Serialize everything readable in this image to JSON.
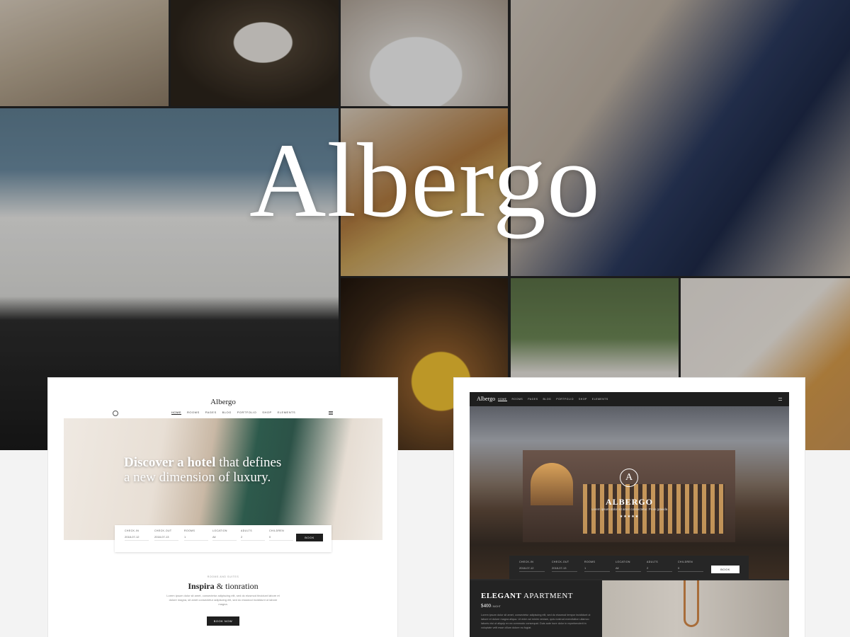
{
  "brand": {
    "name": "Albergo"
  },
  "light_demo": {
    "logo": "Albergo",
    "nav": [
      "HOME",
      "ROOMS",
      "PAGES",
      "BLOG",
      "PORTFOLIO",
      "SHOP",
      "ELEMENTS"
    ],
    "hero": {
      "title_bold": "Discover a hotel",
      "title_rest": " that defines",
      "title_line2": "a new dimension of luxury."
    },
    "booking": {
      "fields": [
        {
          "label": "CHECK-IN",
          "value": "2018-07-12"
        },
        {
          "label": "CHECK-OUT",
          "value": "2018-07-13"
        },
        {
          "label": "ROOMS",
          "value": "1"
        },
        {
          "label": "LOCATION",
          "value": "All"
        },
        {
          "label": "ADULTS",
          "value": "2"
        },
        {
          "label": "CHILDREN",
          "value": "0"
        }
      ],
      "button": "BOOK"
    },
    "section": {
      "kicker": "ROOMS AND SUITES",
      "heading_bold": "Inspira",
      "heading_rest": " & tionration",
      "body": "Lorem ipsum dolor sit amet, consectetur adipiscing elit, sed do eiusmod tincidunt labore et dolore magna, sit amet consectetur adipiscing elit, sed do eiusmod incididunt ut labore magna.",
      "cta": "BOOK NOW"
    }
  },
  "dark_demo": {
    "logo": "Albergo",
    "nav": [
      "HOME",
      "ROOMS",
      "PAGES",
      "BLOG",
      "PORTFOLIO",
      "SHOP",
      "ELEMENTS"
    ],
    "hero": {
      "emblem": "A",
      "name": "ALBERGO",
      "subtitle": "Lorem ipsum dolor sit amet consectetur. Proin gravida",
      "stars": "★★★★★"
    },
    "booking": {
      "fields": [
        {
          "label": "CHECK-IN",
          "value": "2018-07-12"
        },
        {
          "label": "CHECK-OUT",
          "value": "2018-07-13"
        },
        {
          "label": "ROOMS",
          "value": "1"
        },
        {
          "label": "LOCATION",
          "value": "All"
        },
        {
          "label": "ADULTS",
          "value": "2"
        },
        {
          "label": "CHILDREN",
          "value": "0"
        }
      ],
      "button": "BOOK"
    },
    "apartment": {
      "title_bold": "ELEGANT",
      "title_rest": " APARTMENT",
      "price": "$400",
      "price_unit": " / NIGHT",
      "body": "Lorem ipsum dolor sit amet, consectetur adipiscing elit, sed do eiusmod tempor incididunt ut labore et dolore magna aliqua. Ut enim ad minim veniam, quis nostrud exercitation ullamco laboris nisi ut aliquip ex ea commodo consequat. Duis aute irure dolor in reprehenderit in voluptate velit esse cillum dolore eu fugiat."
    }
  }
}
